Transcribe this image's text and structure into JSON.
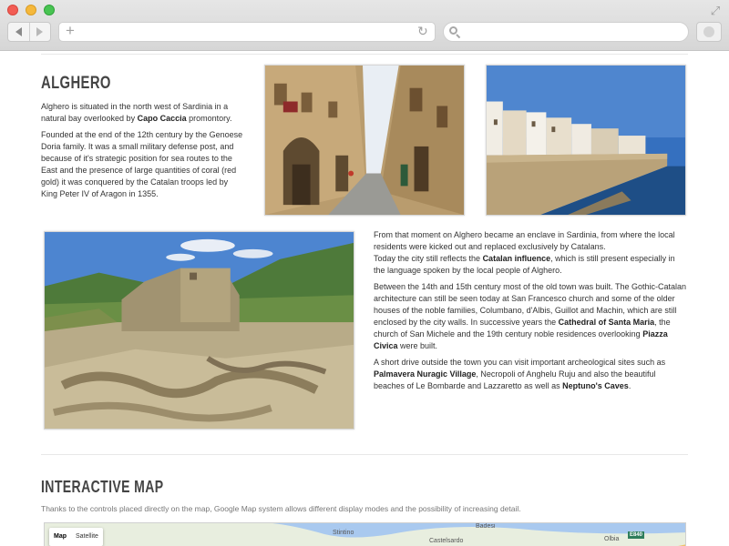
{
  "browser": {
    "url": "",
    "search_placeholder": ""
  },
  "colors": {
    "chrome_bg": "#dcdcdc",
    "text": "#333333",
    "heading": "#444444",
    "sea": "#2f6fb0",
    "map_bg": "#e7efe0"
  },
  "section_alghero": {
    "title": "ALGHERO",
    "intro": {
      "before": "Alghero is situated in the north west of Sardinia in a natural bay overlooked by ",
      "bold": "Capo Caccia",
      "after": " promontory."
    },
    "history": "Founded at the end of the 12th century by the Genoese Doria family. It was a small military defense post, and because of it's strategic position for sea routes to the East and the presence of large quantities of coral (red gold) it was conquered by the Catalan troops led by King Peter IV of Aragon in 1355.",
    "enclave": {
      "line1": "From that moment on Alghero became an enclave in Sardinia, from where the local residents were kicked out and replaced exclusively by Catalans.",
      "line2_before": "Today the city still reflects the ",
      "line2_bold": "Catalan influence",
      "line2_after": ", which is still present especially in the language spoken by the local people of Alghero."
    },
    "architecture": {
      "before": "Between the 14th and 15th century most of the old town was built. The Gothic-Catalan architecture can still be seen today at San Francesco church and some of the older houses of the noble families, Columbano, d'Albis, Guillot and Machin, which are still enclosed by the city walls. In successive years the ",
      "bold1": "Cathedral of Santa Maria",
      "middle": ", the church of San Michele and the 19th century noble residences overlooking ",
      "bold2": "Piazza Civica",
      "after": " were built."
    },
    "excursions": {
      "before": "A short drive outside the town you can visit important archeological sites such as ",
      "bold1": "Palmavera Nuragic Village",
      "middle": ", Necropoli of Anghelu Ruju and also the beautiful beaches of Le Bombarde and Lazzaretto as well as ",
      "bold2": "Neptuno's Caves",
      "after": "."
    }
  },
  "section_map": {
    "title": "INTERACTIVE MAP",
    "description": "Thanks to the controls placed directly on the map, Google Map system allows different display modes and the possibility of increasing detail.",
    "controls": {
      "map": "Map",
      "satellite": "Satellite"
    },
    "places": [
      "Stintino",
      "Castelsardo",
      "Badesi",
      "Olbia"
    ],
    "road_badge": "E840"
  }
}
